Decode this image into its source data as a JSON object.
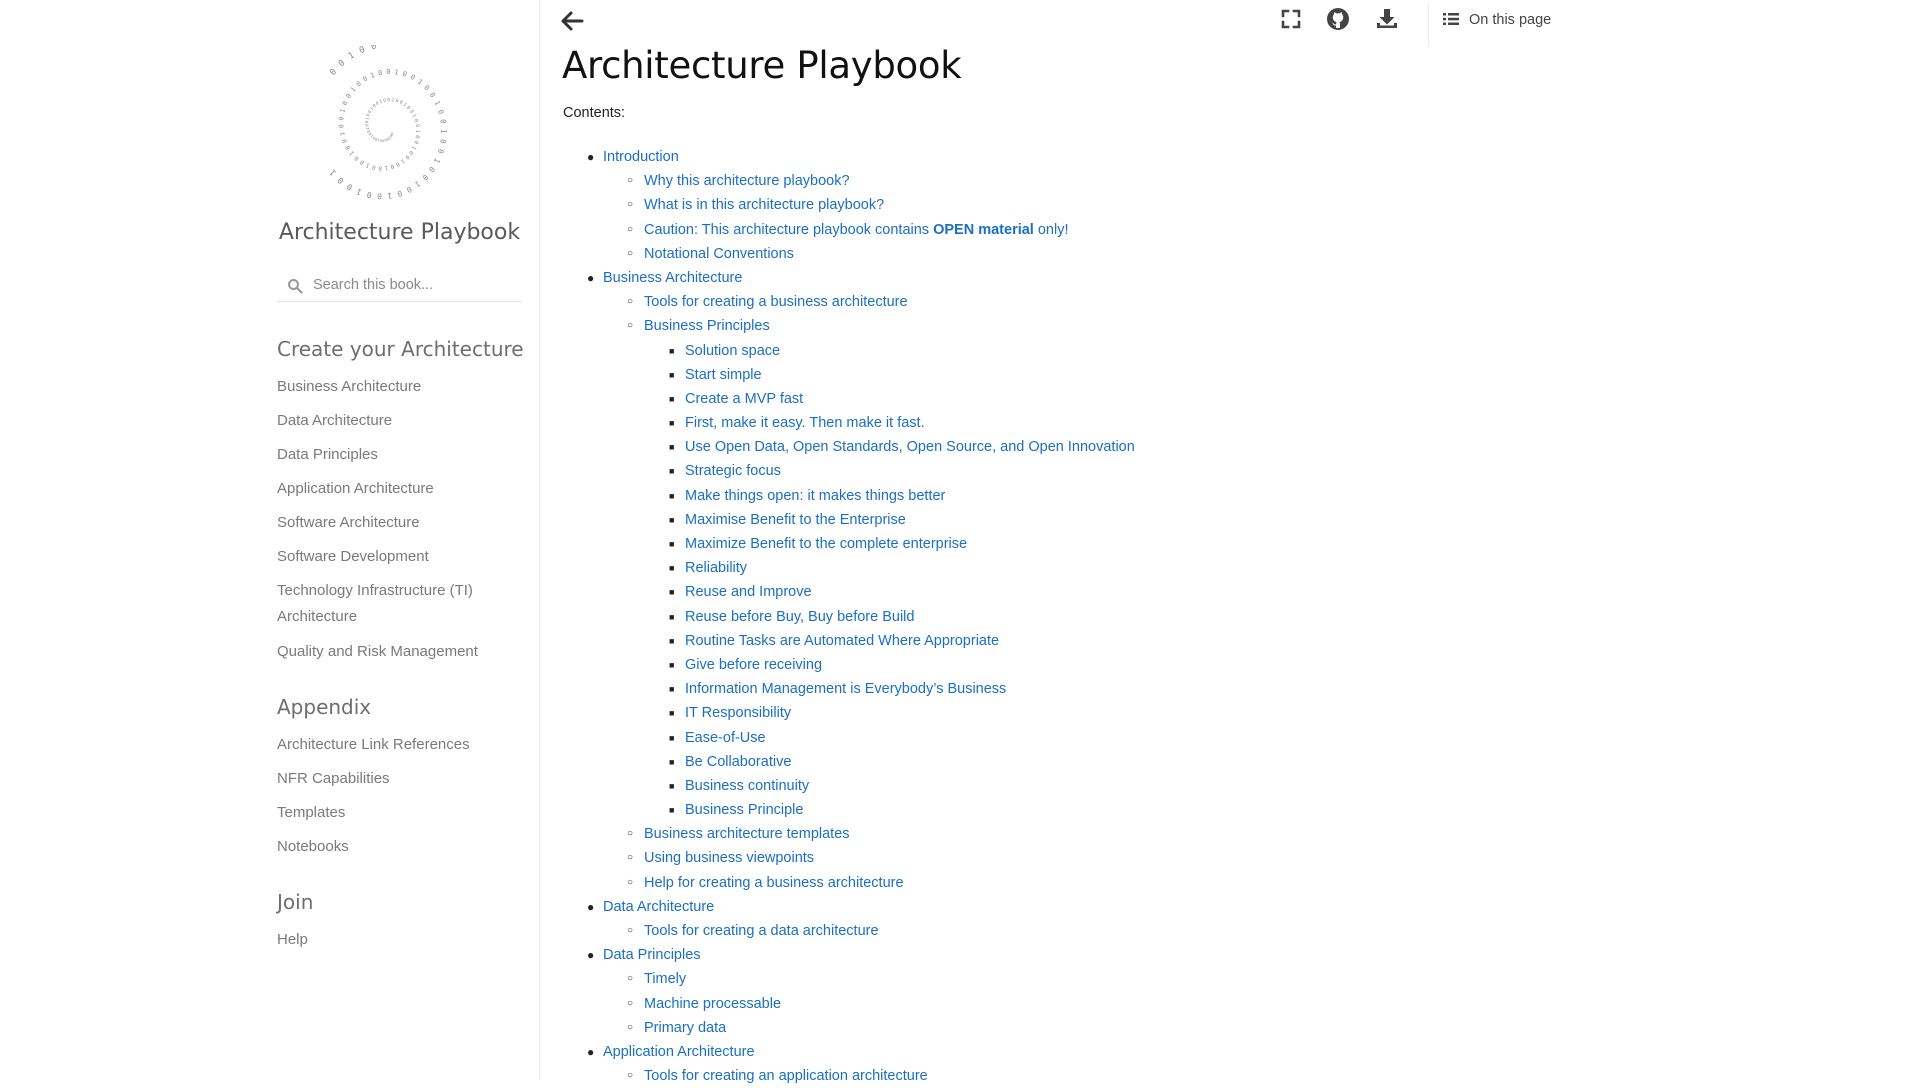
{
  "sidebar": {
    "title": "Architecture Playbook",
    "search_placeholder": "Search this book...",
    "sections": [
      {
        "caption": "Create your Architecture",
        "items": [
          "Business Architecture",
          "Data Architecture",
          "Data Principles",
          "Application Architecture",
          "Software Architecture",
          "Software Development",
          "Technology Infrastructure (TI) Architecture",
          "Quality and Risk Management"
        ]
      },
      {
        "caption": "Appendix",
        "items": [
          "Architecture Link References",
          "NFR Capabilities",
          "Templates",
          "Notebooks"
        ]
      },
      {
        "caption": "Join",
        "items": [
          "Help"
        ]
      }
    ]
  },
  "topbar": {
    "icons": [
      "back-arrow-icon",
      "fullscreen-icon",
      "github-icon",
      "download-icon"
    ],
    "on_this_page": "On this page"
  },
  "main": {
    "title": "Architecture Playbook",
    "contents_label": "Contents:",
    "toc": [
      {
        "level": 1,
        "text": "Introduction"
      },
      {
        "level": 2,
        "text": "Why this architecture playbook?"
      },
      {
        "level": 2,
        "text": "What is in this architecture playbook?"
      },
      {
        "level": 2,
        "text": "Caution: This architecture playbook contains ",
        "bold": "OPEN material",
        "suffix": " only!"
      },
      {
        "level": 2,
        "text": "Notational Conventions"
      },
      {
        "level": 1,
        "text": "Business Architecture"
      },
      {
        "level": 2,
        "text": "Tools for creating a business architecture"
      },
      {
        "level": 2,
        "text": "Business Principles"
      },
      {
        "level": 3,
        "text": "Solution space"
      },
      {
        "level": 3,
        "text": "Start simple"
      },
      {
        "level": 3,
        "text": "Create a MVP fast"
      },
      {
        "level": 3,
        "text": "First, make it easy. Then make it fast."
      },
      {
        "level": 3,
        "text": "Use Open Data, Open Standards, Open Source, and Open Innovation"
      },
      {
        "level": 3,
        "text": "Strategic focus"
      },
      {
        "level": 3,
        "text": "Make things open: it makes things better"
      },
      {
        "level": 3,
        "text": "Maximise Benefit to the Enterprise"
      },
      {
        "level": 3,
        "text": "Maximize Benefit to the complete enterprise"
      },
      {
        "level": 3,
        "text": "Reliability"
      },
      {
        "level": 3,
        "text": "Reuse and Improve"
      },
      {
        "level": 3,
        "text": "Reuse before Buy, Buy before Build"
      },
      {
        "level": 3,
        "text": "Routine Tasks are Automated Where Appropriate"
      },
      {
        "level": 3,
        "text": "Give before receiving"
      },
      {
        "level": 3,
        "text": "Information Management is Everybody’s Business"
      },
      {
        "level": 3,
        "text": "IT Responsibility"
      },
      {
        "level": 3,
        "text": "Ease-of-Use"
      },
      {
        "level": 3,
        "text": "Be Collaborative"
      },
      {
        "level": 3,
        "text": "Business continuity"
      },
      {
        "level": 3,
        "text": "Business Principle"
      },
      {
        "level": 2,
        "text": "Business architecture templates"
      },
      {
        "level": 2,
        "text": "Using business viewpoints"
      },
      {
        "level": 2,
        "text": "Help for creating a business architecture"
      },
      {
        "level": 1,
        "text": "Data Architecture"
      },
      {
        "level": 2,
        "text": "Tools for creating a data architecture"
      },
      {
        "level": 1,
        "text": "Data Principles"
      },
      {
        "level": 2,
        "text": "Timely"
      },
      {
        "level": 2,
        "text": "Machine processable"
      },
      {
        "level": 2,
        "text": "Primary data"
      },
      {
        "level": 1,
        "text": "Application Architecture"
      },
      {
        "level": 2,
        "text": "Tools for creating an application architecture"
      }
    ]
  }
}
